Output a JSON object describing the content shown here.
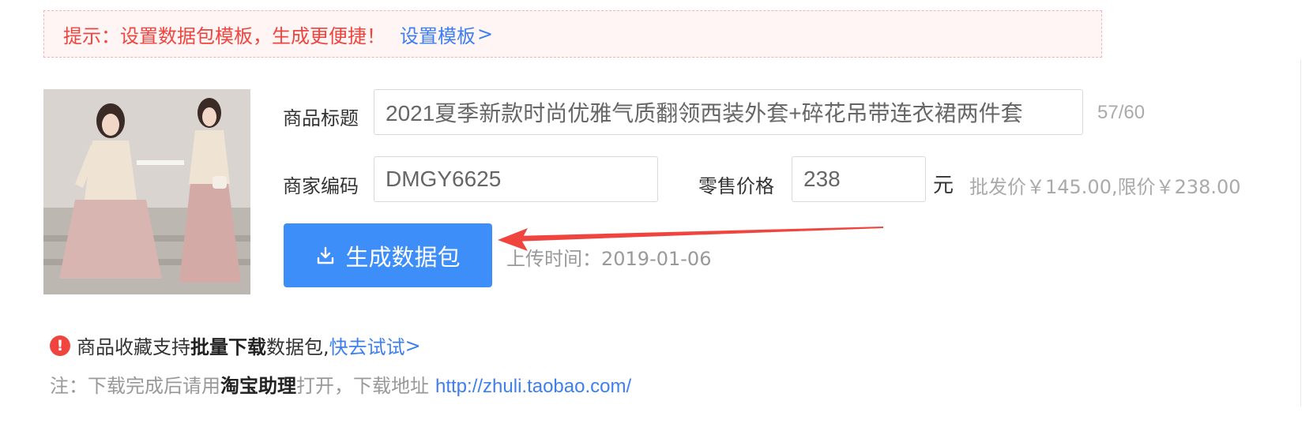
{
  "tip": {
    "text": "提示：设置数据包模板，生成更便捷！",
    "link": "设置模板",
    "chevron": ">"
  },
  "form": {
    "title_label": "商品标题",
    "title_value": "2021夏季新款时尚优雅气质翻领西装外套+碎花吊带连衣裙两件套",
    "title_counter": "57/60",
    "code_label": "商家编码",
    "code_value": "DMGY6625",
    "price_label": "零售价格",
    "price_value": "238",
    "price_unit": "元",
    "price_note": "批发价￥145.00,限价￥238.00"
  },
  "actions": {
    "generate_label": "生成数据包",
    "upload_time": "上传时间：2019-01-06"
  },
  "promo": {
    "icon": "!",
    "text_prefix": "商品收藏支持",
    "text_bold": "批量下载",
    "text_suffix": "数据包,",
    "link": "快去试试",
    "chevron": ">"
  },
  "note": {
    "prefix": "注：下载完成后请用",
    "bold": "淘宝助理",
    "middle": "打开，下载地址",
    "url": "http://zhuli.taobao.com/"
  },
  "colors": {
    "accent": "#3d8ef8",
    "link": "#3d7ff0",
    "warning": "#f0453e",
    "arrow": "#f0453e"
  }
}
